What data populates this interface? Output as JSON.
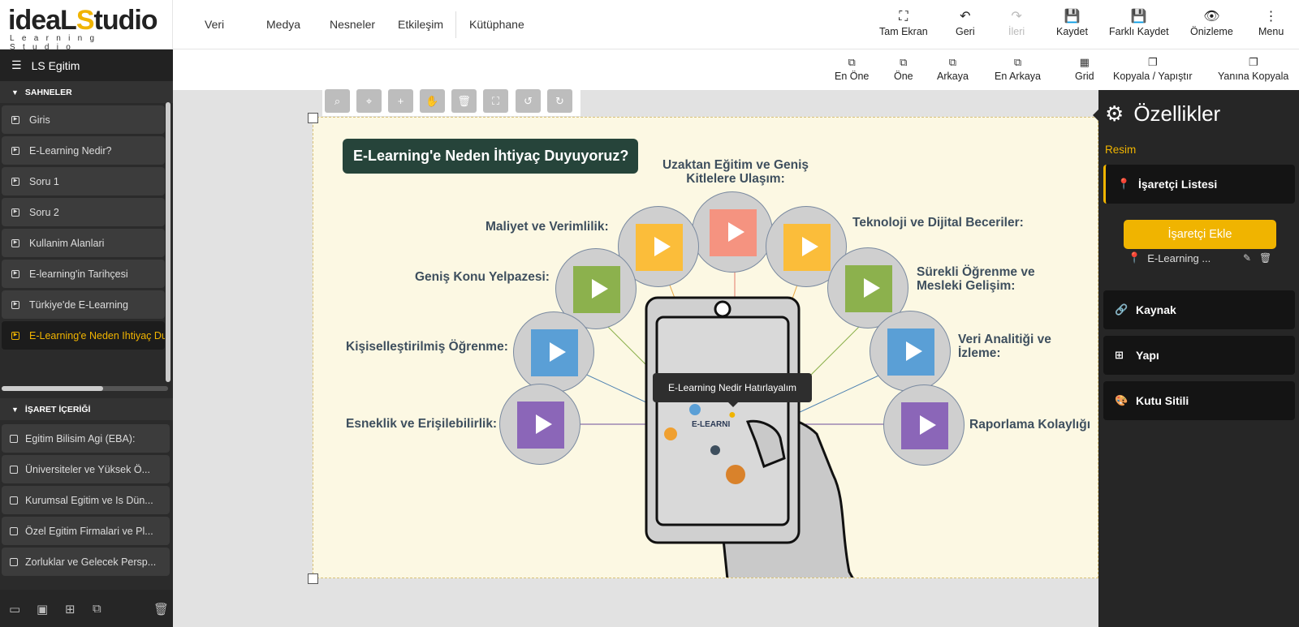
{
  "logo": {
    "main_a": "ideaL",
    "main_b": "S",
    "main_c": "tudio",
    "sub": "Learning Studio"
  },
  "menu": [
    "Veri",
    "Medya",
    "Nesneler",
    "Etkileşim",
    "Kütüphane"
  ],
  "toolbar": {
    "fullscreen": "Tam Ekran",
    "back": "Geri",
    "forward": "İleri",
    "save": "Kaydet",
    "save_as": "Farklı Kaydet",
    "preview": "Önizleme",
    "menu": "Menu"
  },
  "toolbar2": {
    "front_most": "En Öne",
    "front": "Öne",
    "back": "Arkaya",
    "back_most": "En Arkaya",
    "grid": "Grid",
    "copy_paste": "Kopyala / Yapıştır",
    "copy_side": "Yanına Kopyala"
  },
  "sidebar": {
    "project": "LS Egitim",
    "scenes_header": "SAHNELER",
    "scenes": [
      "Giris",
      "E-Learning Nedir?",
      "Soru 1",
      "Soru 2",
      "Kullanim Alanlari",
      "E-learning'in Tarihçesi",
      "Türkiye'de E-Learning",
      "E-Learning'e Neden Ihtiyaç Duyuyoruz?"
    ],
    "active_scene": 7,
    "marks_header": "İŞARET İÇERİĞİ",
    "marks": [
      "Egitim Bilisim Agi (EBA):",
      "Üniversiteler ve Yüksek Ö...",
      "Kurumsal Egitim ve Is Dün...",
      "Özel Egitim Firmalari ve Pl...",
      "Zorluklar ve Gelecek Persp..."
    ]
  },
  "stage": {
    "title": "E-Learning'e Neden İhtiyaç Duyuyoruz?",
    "labels": {
      "uzaktan": "Uzaktan Eğitim ve Geniş Kitlelere Ulaşım:",
      "maliyet": "Maliyet ve Verimlilik:",
      "teknoloji": "Teknoloji ve Dijital Beceriler:",
      "genis": "Geniş Konu Yelpazesi:",
      "surekli": "Sürekli Öğrenme ve Mesleki Gelişim:",
      "kisisel": "Kişiselleştirilmiş Öğrenme:",
      "veri": "Veri Analitiği ve İzleme:",
      "esneklik": "Esneklik ve Erişilebilirlik:",
      "raporlama": "Raporlama Kolaylığı"
    },
    "tablet_text": "E-LEARNI",
    "tooltip": "E-Learning Nedir Hatırlayalım",
    "colors": {
      "orange": "#f59380",
      "yellow": "#fbbd3a",
      "green": "#8cb14d",
      "blue": "#5a9fd6",
      "purple": "#8b66b8"
    }
  },
  "panel": {
    "title": "Özellikler",
    "subtitle": "Resim",
    "markers_title": "İşaretçi Listesi",
    "add_marker": "İşaretçi Ekle",
    "marker_item": "E-Learning ...",
    "source": "Kaynak",
    "structure": "Yapı",
    "box_style": "Kutu Sitili"
  }
}
